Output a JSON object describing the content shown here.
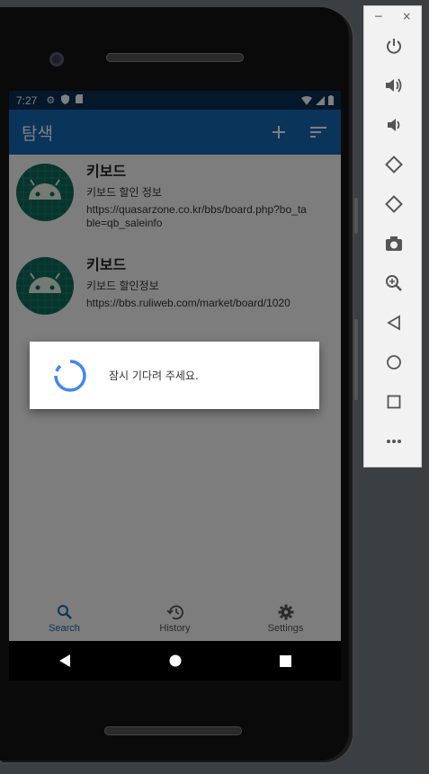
{
  "status_bar": {
    "time": "7:27"
  },
  "app_bar": {
    "title": "탐색"
  },
  "items": [
    {
      "title": "키보드",
      "subtitle": "키보드 할인 정보",
      "url": "https://quasarzone.co.kr/bbs/board.php?bo_table=qb_saleinfo"
    },
    {
      "title": "키보드",
      "subtitle": "키보드 할인정보",
      "url": "https://bbs.ruliweb.com/market/board/1020"
    }
  ],
  "dialog": {
    "message": "잠시 기다려 주세요."
  },
  "bottom_nav": [
    {
      "label": "Search",
      "icon": "search-icon",
      "active": true
    },
    {
      "label": "History",
      "icon": "history-icon",
      "active": false
    },
    {
      "label": "Settings",
      "icon": "gear-icon",
      "active": false
    }
  ],
  "emulator_toolbar": {
    "window_controls": [
      "−",
      "×"
    ],
    "buttons": [
      "power-icon",
      "volume-up-icon",
      "volume-down-icon",
      "rotate-left-icon",
      "rotate-right-icon",
      "camera-icon",
      "zoom-icon",
      "back-icon",
      "home-icon",
      "overview-icon",
      "more-icon"
    ]
  },
  "colors": {
    "primary": "#1769b7",
    "status_bar": "#0b2f57",
    "avatar": "#0c6b5a",
    "spinner": "#4285f4"
  }
}
